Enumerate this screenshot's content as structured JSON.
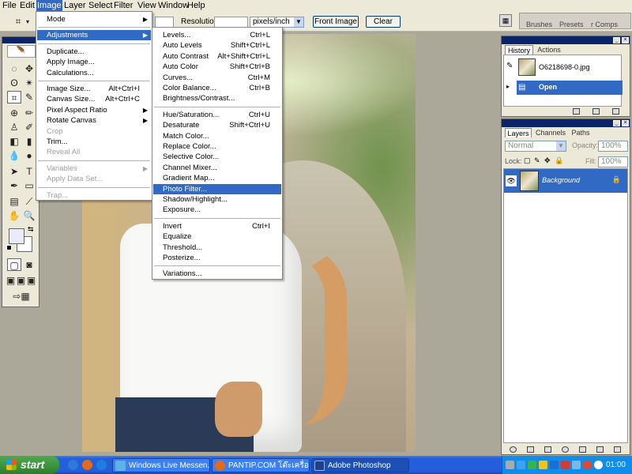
{
  "menubar": {
    "items": [
      "File",
      "Edit",
      "Image",
      "Layer",
      "Select",
      "Filter",
      "View",
      "Window",
      "Help"
    ],
    "active": "Image"
  },
  "options_bar": {
    "resolution_label": "Resolution:",
    "units": "pixels/inch",
    "front_image_btn": "Front Image",
    "clear_btn": "Clear"
  },
  "palette_well": {
    "tabs": [
      "Brushes",
      "Presets",
      "r Comps"
    ]
  },
  "image_menu": {
    "items": [
      {
        "label": "Mode",
        "submenu": true
      },
      {
        "sep": true
      },
      {
        "label": "Adjustments",
        "submenu": true,
        "highlighted": true
      },
      {
        "sep": true
      },
      {
        "label": "Duplicate..."
      },
      {
        "label": "Apply Image..."
      },
      {
        "label": "Calculations..."
      },
      {
        "sep": true
      },
      {
        "label": "Image Size...",
        "shortcut": "Alt+Ctrl+I"
      },
      {
        "label": "Canvas Size...",
        "shortcut": "Alt+Ctrl+C"
      },
      {
        "label": "Pixel Aspect Ratio",
        "submenu": true
      },
      {
        "label": "Rotate Canvas",
        "submenu": true
      },
      {
        "label": "Crop",
        "disabled": true
      },
      {
        "label": "Trim..."
      },
      {
        "label": "Reveal All",
        "disabled": true
      },
      {
        "sep": true
      },
      {
        "label": "Variables",
        "submenu": true,
        "disabled": true
      },
      {
        "label": "Apply Data Set...",
        "disabled": true
      },
      {
        "sep": true
      },
      {
        "label": "Trap...",
        "disabled": true
      }
    ]
  },
  "adjustments_menu": {
    "items": [
      {
        "label": "Levels...",
        "shortcut": "Ctrl+L"
      },
      {
        "label": "Auto Levels",
        "shortcut": "Shift+Ctrl+L"
      },
      {
        "label": "Auto Contrast",
        "shortcut": "Alt+Shift+Ctrl+L"
      },
      {
        "label": "Auto Color",
        "shortcut": "Shift+Ctrl+B"
      },
      {
        "label": "Curves...",
        "shortcut": "Ctrl+M"
      },
      {
        "label": "Color Balance...",
        "shortcut": "Ctrl+B"
      },
      {
        "label": "Brightness/Contrast..."
      },
      {
        "sep": true
      },
      {
        "label": "Hue/Saturation...",
        "shortcut": "Ctrl+U"
      },
      {
        "label": "Desaturate",
        "shortcut": "Shift+Ctrl+U"
      },
      {
        "label": "Match Color..."
      },
      {
        "label": "Replace Color..."
      },
      {
        "label": "Selective Color..."
      },
      {
        "label": "Channel Mixer..."
      },
      {
        "label": "Gradient Map..."
      },
      {
        "label": "Photo Filter...",
        "highlighted": true
      },
      {
        "label": "Shadow/Highlight..."
      },
      {
        "label": "Exposure..."
      },
      {
        "sep": true
      },
      {
        "label": "Invert",
        "shortcut": "Ctrl+I"
      },
      {
        "label": "Equalize"
      },
      {
        "label": "Threshold..."
      },
      {
        "label": "Posterize..."
      },
      {
        "sep": true
      },
      {
        "label": "Variations..."
      }
    ]
  },
  "history_palette": {
    "tabs": [
      "History",
      "Actions"
    ],
    "snapshot_label": "O6218698-0.jpg",
    "state_label": "Open"
  },
  "layers_palette": {
    "tabs": [
      "Layers",
      "Channels",
      "Paths"
    ],
    "blend_mode": "Normal",
    "opacity_label": "Opacity:",
    "opacity_value": "100%",
    "lock_label": "Lock:",
    "fill_label": "Fill:",
    "fill_value": "100%",
    "layer_name": "Background"
  },
  "taskbar": {
    "start_label": "start",
    "tasks": [
      "Windows Live Messen...",
      "PANTIP.COM โต๊ะเครื่อ...",
      "Adobe Photoshop"
    ],
    "active_task": "Adobe Photoshop",
    "clock": "01:00"
  },
  "colors": {
    "accent_highlight": "#316ac5",
    "menu_bg": "#ece9d8",
    "palette_title": "#0a246a",
    "taskbar_blue": "#245edb",
    "start_green": "#3a933a"
  }
}
